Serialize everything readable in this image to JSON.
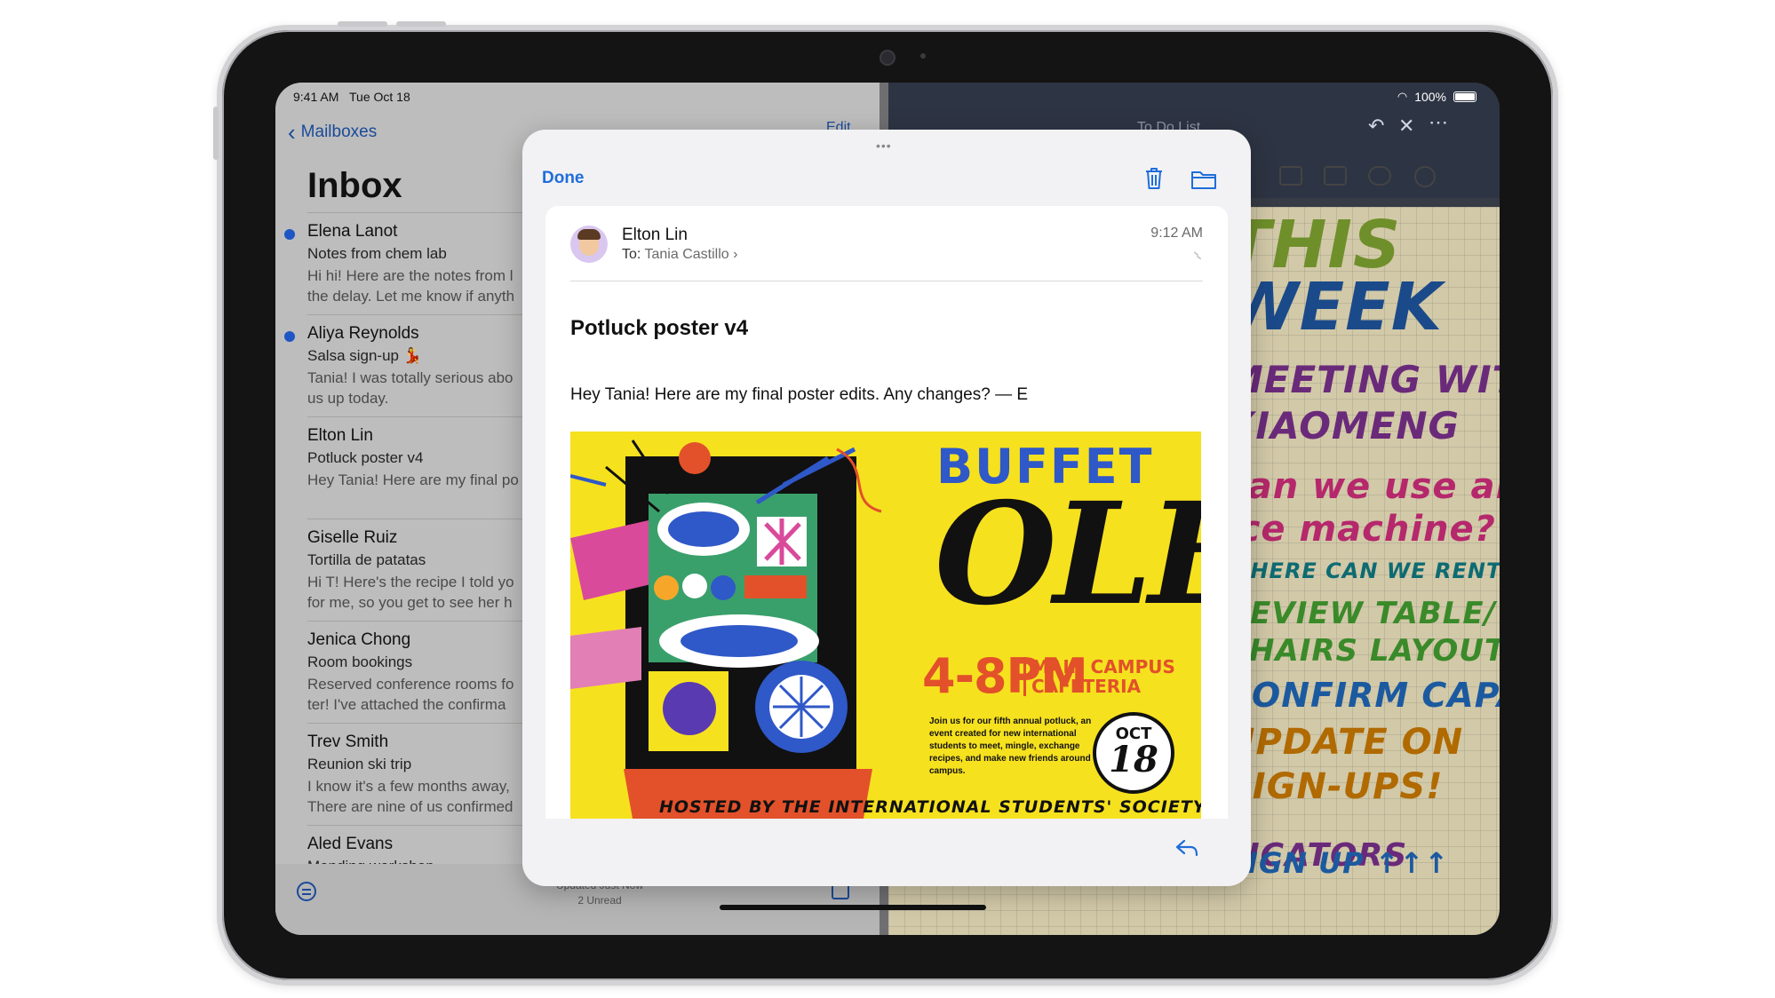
{
  "status_bar": {
    "time": "9:41 AM",
    "date": "Tue Oct 18",
    "battery": "100%"
  },
  "mail": {
    "back_label": "Mailboxes",
    "edit_label": "Edit",
    "inbox_title": "Inbox",
    "messages": [
      {
        "sender": "Elena Lanot",
        "subject": "Notes from chem lab",
        "preview": "Hi hi! Here are the notes from l\nthe delay. Let me know if anyth",
        "unread": true
      },
      {
        "sender": "Aliya Reynolds",
        "subject": "Salsa sign-up 💃",
        "preview": "Tania! I was totally serious abo\nus up today.",
        "unread": true
      },
      {
        "sender": "Elton Lin",
        "subject": "Potluck poster v4",
        "preview": "Hey Tania! Here are my final po",
        "unread": false
      },
      {
        "sender": "Giselle Ruiz",
        "subject": "Tortilla de patatas",
        "preview": "Hi T! Here's the recipe I told yo\nfor me, so you get to see her h",
        "unread": false
      },
      {
        "sender": "Jenica Chong",
        "subject": "Room bookings",
        "preview": "Reserved conference rooms fo\nter! I've attached the confirma",
        "unread": false
      },
      {
        "sender": "Trev Smith",
        "subject": "Reunion ski trip",
        "preview": "I know it's a few months away,\nThere are nine of us confirmed",
        "unread": false
      },
      {
        "sender": "Aled Evans",
        "subject": "Mending workshop",
        "preview": "",
        "unread": false
      }
    ],
    "footer_updated": "Updated Just Now",
    "footer_unread": "2 Unread"
  },
  "notes": {
    "title": "To Do List",
    "lines": {
      "this": "THIS",
      "week": "WEEK",
      "meeting": "MEETING WITH",
      "xiaomeng": "XIAOMENG",
      "ice1": "can we use an",
      "ice2": "ice machine?",
      "rent": "WHERE CAN WE RENT ONE?",
      "review": "REVIEW TABLE/",
      "chairs": "CHAIRS LAYOUT",
      "confirm": "CONFIRM CAPACITY",
      "update": "UPDATE ON",
      "signups": "SIGN-UPS!",
      "allergen": "ALLERGEN INDICATORS",
      "signup": "SIGN UP ↑↑↑"
    }
  },
  "card": {
    "done_label": "Done",
    "sender_name": "Elton Lin",
    "to_label": "To:",
    "to_value": "Tania Castillo",
    "time": "9:12 AM",
    "subject": "Potluck poster v4",
    "body": "Hey Tania! Here are my final poster edits. Any changes? — E",
    "poster": {
      "title": "BUFFET",
      "headline": "OLÉ",
      "time": "4-8PM",
      "location_line1": "MAIN CAMPUS",
      "location_line2": "CAFETERIA",
      "description": "Join us for our fifth annual potluck, an event created for new international students to meet, mingle, exchange recipes, and make new friends around campus.",
      "date_month": "OCT",
      "date_day": "18",
      "host": "HOSTED BY THE INTERNATIONAL STUDENTS' SOCIETY"
    }
  },
  "colors": {
    "accent": "#1f6dda",
    "poster_yellow": "#f6e11f",
    "poster_blue": "#2f58c8",
    "poster_orange": "#e2512a"
  }
}
